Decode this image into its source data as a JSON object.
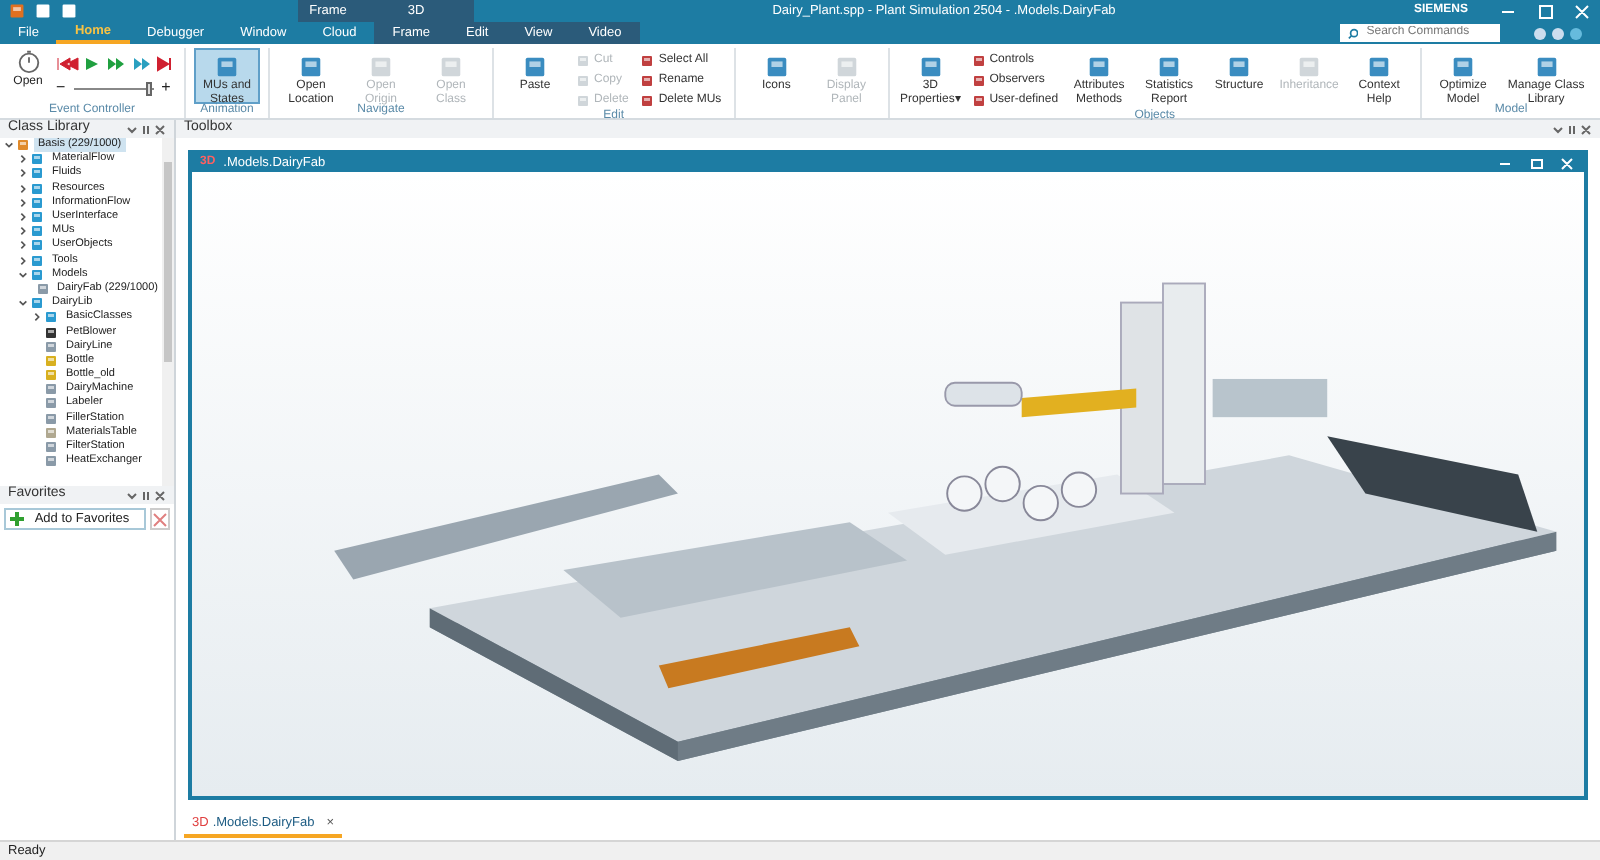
{
  "window": {
    "title": "Dairy_Plant.spp - Plant Simulation 2504 - .Models.DairyFab",
    "brand": "SIEMENS"
  },
  "context_headers": [
    {
      "label": "Frame"
    },
    {
      "label": "3D"
    }
  ],
  "tabs": [
    {
      "label": "File",
      "selected": false,
      "context": false
    },
    {
      "label": "Home",
      "selected": true,
      "context": false
    },
    {
      "label": "Debugger",
      "selected": false,
      "context": false
    },
    {
      "label": "Window",
      "selected": false,
      "context": false
    },
    {
      "label": "Cloud",
      "selected": false,
      "context": false
    },
    {
      "label": "Frame",
      "selected": false,
      "context": true
    },
    {
      "label": "Edit",
      "selected": false,
      "context": true
    },
    {
      "label": "View",
      "selected": false,
      "context": true
    },
    {
      "label": "Video",
      "selected": false,
      "context": true
    }
  ],
  "search": {
    "placeholder": "Search Commands"
  },
  "event_controller": {
    "label": "Event Controller",
    "open": "Open",
    "speed_slider": {
      "level": 0.95
    },
    "minus": "−",
    "plus": "+"
  },
  "groups": [
    {
      "label": "Animation",
      "buttons": [
        {
          "label": "MUs and States",
          "kind": "large",
          "disabled": false,
          "selected": true
        }
      ]
    },
    {
      "label": "Navigate",
      "buttons": [
        {
          "label": "Open Location",
          "kind": "large",
          "disabled": false,
          "selected": false
        },
        {
          "label": "Open Origin",
          "kind": "large",
          "disabled": true,
          "selected": false
        },
        {
          "label": "Open Class",
          "kind": "large",
          "disabled": true,
          "selected": false
        }
      ]
    },
    {
      "label": "Edit",
      "buttons": [
        {
          "label": "Paste",
          "kind": "large",
          "disabled": false,
          "selected": false
        },
        {
          "label": "Cut",
          "kind": "small",
          "disabled": true,
          "selected": false
        },
        {
          "label": "Copy",
          "kind": "small",
          "disabled": true,
          "selected": false
        },
        {
          "label": "Delete",
          "kind": "small",
          "disabled": true,
          "selected": false
        },
        {
          "label": "Select All",
          "kind": "small",
          "disabled": false,
          "selected": false
        },
        {
          "label": "Rename",
          "kind": "small",
          "disabled": false,
          "selected": false
        },
        {
          "label": "Delete MUs",
          "kind": "small",
          "disabled": false,
          "selected": false
        }
      ]
    },
    {
      "buttons": [
        {
          "label": "Icons",
          "kind": "large",
          "disabled": false,
          "selected": false
        },
        {
          "label": "Display Panel",
          "kind": "large",
          "disabled": true,
          "selected": false
        }
      ]
    },
    {
      "label": "Objects",
      "buttons": [
        {
          "label": "3D Properties▾",
          "kind": "large",
          "disabled": false,
          "selected": false
        },
        {
          "label": "Controls",
          "kind": "small",
          "disabled": false,
          "selected": false
        },
        {
          "label": "Observers",
          "kind": "small",
          "disabled": false,
          "selected": false
        },
        {
          "label": "User-defined",
          "kind": "small",
          "disabled": false,
          "selected": false
        },
        {
          "label": "Attributes Methods",
          "kind": "large",
          "disabled": false,
          "selected": false
        },
        {
          "label": "Statistics Report",
          "kind": "large",
          "disabled": false,
          "selected": false
        },
        {
          "label": "Structure",
          "kind": "large",
          "disabled": false,
          "selected": false
        },
        {
          "label": "Inheritance",
          "kind": "large",
          "disabled": true,
          "selected": false
        },
        {
          "label": "Context Help",
          "kind": "large",
          "disabled": false,
          "selected": false
        }
      ]
    },
    {
      "label": "Model",
      "buttons": [
        {
          "label": "Optimize Model",
          "kind": "large",
          "disabled": false,
          "selected": false
        },
        {
          "label": "Manage Class Library",
          "kind": "large",
          "disabled": false,
          "selected": false
        }
      ]
    }
  ],
  "class_library": {
    "title": "Class Library",
    "items": [
      {
        "label": "Basis (229/1000)",
        "selected": true,
        "expanded": true,
        "kind": "root",
        "children": [
          {
            "label": "MaterialFlow",
            "selected": false,
            "expanded": false,
            "kind": "folder"
          },
          {
            "label": "Fluids",
            "selected": false,
            "expanded": false,
            "kind": "folder"
          },
          {
            "label": "Resources",
            "selected": false,
            "expanded": false,
            "kind": "folder"
          },
          {
            "label": "InformationFlow",
            "selected": false,
            "expanded": false,
            "kind": "folder"
          },
          {
            "label": "UserInterface",
            "selected": false,
            "expanded": false,
            "kind": "folder"
          },
          {
            "label": "MUs",
            "selected": false,
            "expanded": false,
            "kind": "folder"
          },
          {
            "label": "UserObjects",
            "selected": false,
            "expanded": false,
            "kind": "folder"
          },
          {
            "label": "Tools",
            "selected": false,
            "expanded": false,
            "kind": "folder"
          },
          {
            "label": "Models",
            "selected": false,
            "expanded": true,
            "kind": "folder",
            "children": [
              {
                "label": "DairyFab (229/1000)",
                "selected": false,
                "kind": "frame"
              }
            ]
          },
          {
            "label": "DairyLib",
            "selected": false,
            "expanded": true,
            "kind": "folder",
            "children": [
              {
                "label": "BasicClasses",
                "selected": false,
                "expanded": false,
                "kind": "folder"
              },
              {
                "label": "PetBlower",
                "selected": false,
                "kind": "arrow"
              },
              {
                "label": "DairyLine",
                "selected": false,
                "kind": "frame"
              },
              {
                "label": "Bottle",
                "selected": false,
                "kind": "part"
              },
              {
                "label": "Bottle_old",
                "selected": false,
                "kind": "part"
              },
              {
                "label": "DairyMachine",
                "selected": false,
                "kind": "frame"
              },
              {
                "label": "Labeler",
                "selected": false,
                "kind": "frame"
              },
              {
                "label": "FillerStation",
                "selected": false,
                "kind": "frame"
              },
              {
                "label": "MaterialsTable",
                "selected": false,
                "kind": "table"
              },
              {
                "label": "FilterStation",
                "selected": false,
                "kind": "frame"
              },
              {
                "label": "HeatExchanger",
                "selected": false,
                "kind": "frame"
              }
            ]
          }
        ]
      }
    ]
  },
  "toolbox": {
    "title": "Toolbox"
  },
  "favorites": {
    "title": "Favorites",
    "add_button": "Add to Favorites"
  },
  "model_window": {
    "badge": "3D",
    "title": ".Models.DairyFab"
  },
  "doc_tabs": [
    {
      "badge": "3D",
      "label": ".Models.DairyFab",
      "selected": true,
      "close": "×"
    }
  ],
  "status_bar": {
    "text": "Ready"
  }
}
